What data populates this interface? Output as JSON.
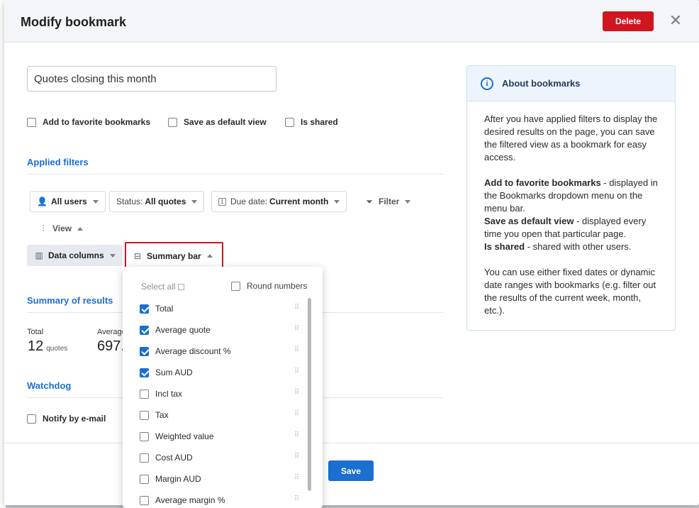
{
  "modal": {
    "title": "Modify bookmark",
    "delete_label": "Delete",
    "save_label": "Save",
    "name_value": "Quotes closing this month"
  },
  "options": {
    "favorite": "Add to favorite bookmarks",
    "default_view": "Save as default view",
    "is_shared": "Is shared"
  },
  "sections": {
    "applied_filters": "Applied filters",
    "summary": "Summary of results",
    "watchdog": "Watchdog"
  },
  "filters": {
    "users": "All users",
    "status_label": "Status:",
    "status_value": "All quotes",
    "due_label": "Due date:",
    "due_value": "Current month",
    "filter": "Filter",
    "view": "View",
    "data_columns": "Data columns",
    "summary_bar": "Summary bar"
  },
  "summary": {
    "total_label": "Total",
    "total_value": "12",
    "total_unit": "quotes",
    "average_label": "Average",
    "average_value": "697."
  },
  "watchdog": {
    "notify": "Notify by e-mail"
  },
  "dropdown": {
    "select_all": "Select all",
    "round_numbers": "Round numbers",
    "items": [
      {
        "label": "Total",
        "checked": true
      },
      {
        "label": "Average quote",
        "checked": true
      },
      {
        "label": "Average discount %",
        "checked": true
      },
      {
        "label": "Sum AUD",
        "checked": true
      },
      {
        "label": "Incl tax",
        "checked": false
      },
      {
        "label": "Tax",
        "checked": false
      },
      {
        "label": "Weighted value",
        "checked": false
      },
      {
        "label": "Cost AUD",
        "checked": false
      },
      {
        "label": "Margin AUD",
        "checked": false
      },
      {
        "label": "Average margin %",
        "checked": false
      }
    ]
  },
  "about": {
    "title": "About bookmarks",
    "intro": "After you have applied filters to display the desired results on the page, you can save the filtered view as a bookmark for easy access.",
    "fav_term": "Add to favorite bookmarks",
    "fav_desc": " - displayed in the Bookmarks dropdown menu on the menu bar.",
    "default_term": "Save as default view",
    "default_desc": " - displayed every time you open that particular page.",
    "shared_term": "Is shared",
    "shared_desc": " - shared with other users.",
    "dates": "You can use either fixed dates or dynamic date ranges with bookmarks (e.g. filter out the results of the current week, month, etc.)."
  }
}
